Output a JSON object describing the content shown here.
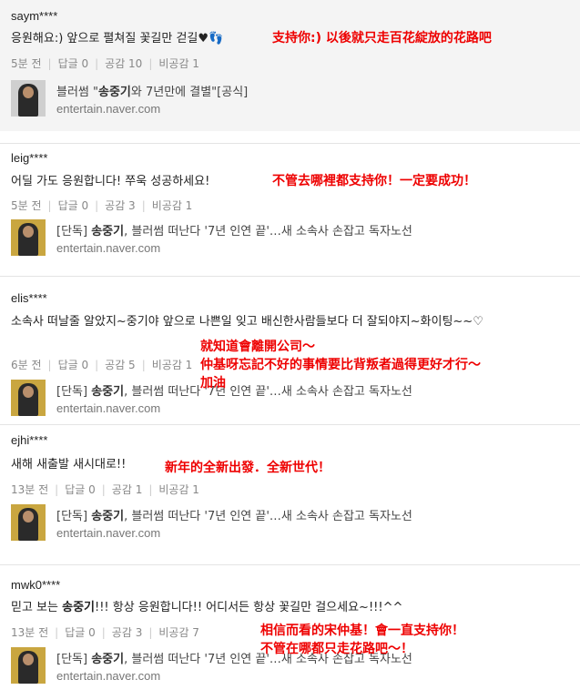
{
  "comments": [
    {
      "user": "saym****",
      "text": "응원해요:) 앞으로 펼쳐질 꽃길만 걷길♥︎︎👣",
      "time": "5분 전",
      "reply": "답글 0",
      "like": "공감 10",
      "dislike": "비공감 1",
      "link_prefix": "블러썸 \"",
      "link_bold": "송중기",
      "link_suffix": "와 7년만에 결별\"[공식]",
      "link_source": "entertain.naver.com",
      "note": "支持你:) 以後就只走百花綻放的花路吧"
    },
    {
      "user": "leig****",
      "text": "어딜 가도 응원합니다! 쭈욱 성공하세요!",
      "time": "5분 전",
      "reply": "답글 0",
      "like": "공감 3",
      "dislike": "비공감 1",
      "link_prefix": "[단독] ",
      "link_bold": "송중기",
      "link_suffix": ", 블러썸 떠난다 '7년 인연 끝'…새 소속사 손잡고 독자노선",
      "link_source": "entertain.naver.com",
      "note": "不管去哪裡都支持你！一定要成功！"
    },
    {
      "user": "elis****",
      "text": "소속사 떠날줄 알았지~중기야 앞으로 나쁜일 잊고 배신한사람들보다 더 잘되야지~화이팅~~♡",
      "time": "6분 전",
      "reply": "답글 0",
      "like": "공감 5",
      "dislike": "비공감 1",
      "link_prefix": "[단독] ",
      "link_bold": "송중기",
      "link_suffix": ", 블러썸 떠난다 '7년 인연 끝'…새 소속사 손잡고 독자노선",
      "link_source": "entertain.naver.com",
      "note_lines": [
        "就知道會離開公司～",
        "仲基呀忘記不好的事情要比背叛者過得更好才行～",
        "加油"
      ]
    },
    {
      "user": "ejhi****",
      "text": "새해 새출발 새시대로!!",
      "time": "13분 전",
      "reply": "답글 0",
      "like": "공감 1",
      "dislike": "비공감 1",
      "link_prefix": "[단독] ",
      "link_bold": "송중기",
      "link_suffix": ", 블러썸 떠난다 '7년 인연 끝'…새 소속사 손잡고 독자노선",
      "link_source": "entertain.naver.com",
      "note": "新年的全新出發．全新世代！"
    },
    {
      "user": "mwk0****",
      "text_prefix": "믿고 보는 ",
      "text_bold": "송중기",
      "text_suffix": "!!! 항상 응원합니다!! 어디서든 항상 꽃길만 걸으세요~!!!^^",
      "time": "13분 전",
      "reply": "답글 0",
      "like": "공감 3",
      "dislike": "비공감 7",
      "link_prefix": "[단독] ",
      "link_bold": "송중기",
      "link_suffix": ", 블러썸 떠난다 '7년 인연 끝'…새 소속사 손잡고 독자노선",
      "link_source": "entertain.naver.com",
      "note_lines": [
        "相信而看的宋仲基！會一直支持你！",
        "不管在哪都只走花路吧～！"
      ]
    }
  ]
}
